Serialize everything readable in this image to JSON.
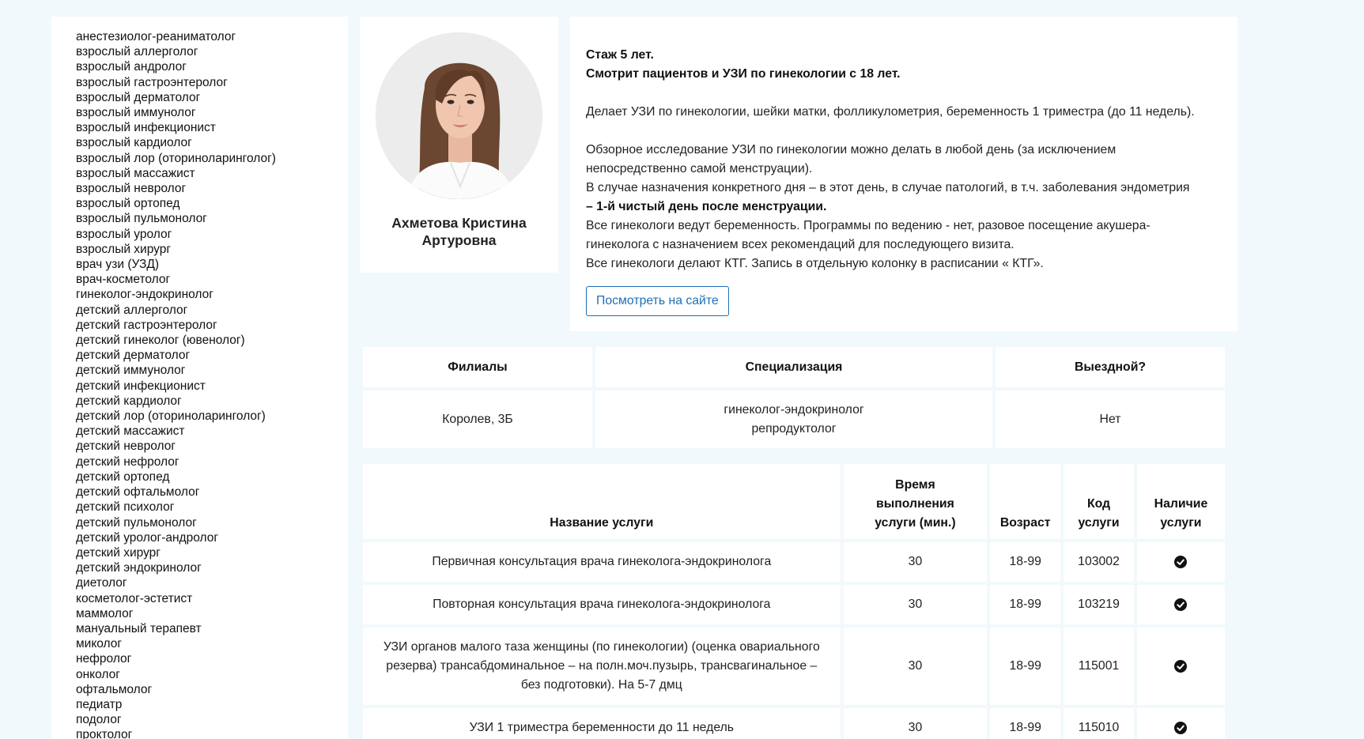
{
  "sidebar": {
    "specialties": [
      "анестезиолог-реаниматолог",
      "взрослый аллерголог",
      "взрослый андролог",
      "взрослый гастроэнтеролог",
      "взрослый дерматолог",
      "взрослый иммунолог",
      "взрослый инфекционист",
      "взрослый кардиолог",
      "взрослый лор (оториноларинголог)",
      "взрослый массажист",
      "взрослый невролог",
      "взрослый ортопед",
      "взрослый пульмонолог",
      "взрослый уролог",
      "взрослый хирург",
      "врач узи (УЗД)",
      "врач-косметолог",
      "гинеколог-эндокринолог",
      "детский аллерголог",
      "детский гастроэнтеролог",
      "детский гинеколог (ювенолог)",
      "детский дерматолог",
      "детский иммунолог",
      "детский инфекционист",
      "детский кардиолог",
      "детский лор (оториноларинголог)",
      "детский массажист",
      "детский невролог",
      "детский нефролог",
      "детский ортопед",
      "детский офтальмолог",
      "детский психолог",
      "детский пульмонолог",
      "детский уролог-андролог",
      "детский хирург",
      "детский эндокринолог",
      "диетолог",
      "косметолог-эстетист",
      "маммолог",
      "мануальный терапевт",
      "миколог",
      "нефролог",
      "онколог",
      "офтальмолог",
      "педиатр",
      "подолог",
      "проктолог"
    ]
  },
  "doctor": {
    "name": "Ахметова Кристина Артуровна"
  },
  "info": {
    "experience": "Стаж 5 лет.",
    "sees_patients": "Смотрит пациентов и УЗИ по гинекологии с 18 лет.",
    "ultrasound": "Делает УЗИ по гинекологии, шейки матки, фолликулометрия, беременность 1 триместра (до 11 недель).",
    "overview_line1": "Обзорное исследование УЗИ по гинекологии можно делать в любой день (за исключением",
    "overview_line2": "непосредственно самой менструации).",
    "specific_day_line1": "В случае назначения конкретного дня – в этот день, в случае патологий, в т.ч. заболевания эндометрия",
    "specific_day_line2": "– 1-й чистый день после менструации.",
    "pregnancy_line1": "Все гинекологи ведут беременность. Программы по ведению - нет, разовое посещение акушера-",
    "pregnancy_line2": "гинеколога с назначением всех рекомендаций для последующего визита.",
    "ktg": "Все гинекологи делают КТГ. Запись в отдельную колонку в расписании « КТГ».",
    "site_button": "Посмотреть на сайте"
  },
  "branch_table": {
    "headers": [
      "Филиалы",
      "Специализация",
      "Выездной?"
    ],
    "branch": "Королев, 3Б",
    "specialization_line1": "гинеколог-эндокринолог",
    "specialization_line2": "репродуктолог",
    "visiting": "Нет"
  },
  "services_table": {
    "headers": {
      "name": "Название услуги",
      "time_line1": "Время",
      "time_line2": "выполнения",
      "time_line3": "услуги (мин.)",
      "age": "Возраст",
      "code_line1": "Код",
      "code_line2": "услуги",
      "avail_line1": "Наличие",
      "avail_line2": "услуги"
    },
    "rows": [
      {
        "name": "Первичная консультация врача гинеколога-эндокринолога",
        "time": "30",
        "age": "18-99",
        "code": "103002",
        "available": true
      },
      {
        "name": "Повторная консультация врача гинеколога-эндокринолога",
        "time": "30",
        "age": "18-99",
        "code": "103219",
        "available": true
      },
      {
        "name_line1": "УЗИ органов малого таза женщины (по гинекологии) (оценка овариального",
        "name_line2": "резерва) трансабдоминальное – на полн.моч.пузырь, трансвагинальное –",
        "name_line3": "без подготовки). На 5-7 дмц",
        "time": "30",
        "age": "18-99",
        "code": "115001",
        "available": true
      },
      {
        "name": "УЗИ 1 триместра беременности до 11 недель",
        "time": "30",
        "age": "18-99",
        "code": "115010",
        "available": true
      }
    ]
  },
  "colors": {
    "page_background": "#f1f9fc",
    "link_blue": "#1f6fb5",
    "negative_red": "#e06c6c"
  },
  "icons": {
    "available": "check-circle-icon"
  }
}
